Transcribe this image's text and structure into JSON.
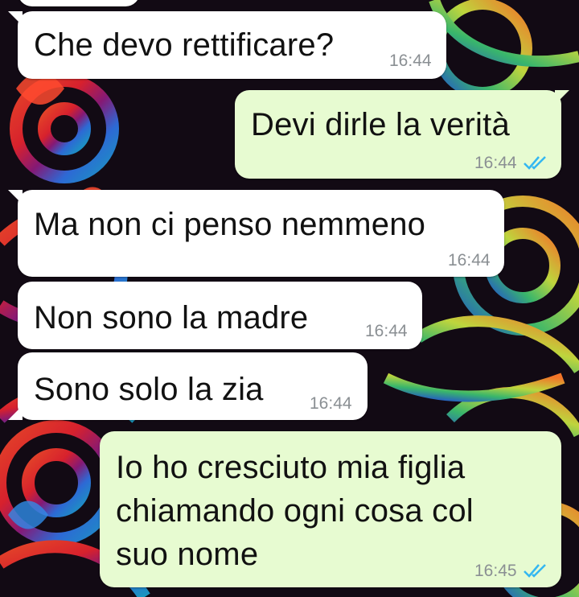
{
  "theme": {
    "incoming_bg": "#ffffff",
    "outgoing_bg": "#e7fbd1",
    "timestamp_color": "#8a8f93",
    "read_tick_color": "#34b7f1"
  },
  "messages": [
    {
      "direction": "incoming",
      "text": "Che devo rettificare?",
      "time": "16:44"
    },
    {
      "direction": "outgoing",
      "text": "Devi dirle la verità",
      "time": "16:44",
      "status": "read-double-check-icon"
    },
    {
      "direction": "incoming",
      "text": "Ma non ci penso nemmeno",
      "time": "16:44"
    },
    {
      "direction": "incoming",
      "text": "Non sono la madre",
      "time": "16:44"
    },
    {
      "direction": "incoming",
      "text": "Sono solo la zia",
      "time": "16:44"
    },
    {
      "direction": "outgoing",
      "lines": [
        "Io ho cresciuto mia figlia",
        "chiamando ogni cosa col",
        "suo nome"
      ],
      "time": "16:45",
      "status": "read-double-check-icon"
    }
  ]
}
